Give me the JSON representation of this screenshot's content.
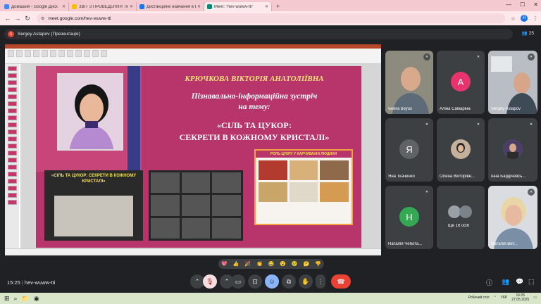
{
  "browser": {
    "tabs": [
      {
        "title": "Домашня - Google Диск",
        "color": "#4285f4",
        "active": false
      },
      {
        "title": "ЗВІТ З ПРОВЕДЕННЯ ТИЖНЯ",
        "color": "#fbbc04",
        "active": false
      },
      {
        "title": "Дистанційне навчання в ВСП",
        "color": "#1a73e8",
        "active": false
      },
      {
        "title": "Meet: \"hev-wuww-tti\"",
        "color": "#00897b",
        "active": true
      }
    ],
    "new_tab": "+",
    "url": "meet.google.com/hev-wuww-tti"
  },
  "meet": {
    "presenter_label": "Sergey Astapov (Презентація)",
    "participant_count": "25",
    "meeting_code": "hev-wuww-tti",
    "time": "15:25",
    "reactions": [
      "💖",
      "👍",
      "🎉",
      "👏",
      "😂",
      "😮",
      "😢",
      "🤔",
      "👎"
    ]
  },
  "slide": {
    "name": "КРЮЧКОВА ВІКТОРІЯ АНАТОЛІЇВНА",
    "subtitle1": "Пізнавально-інформаційна зустріч",
    "subtitle2": "на тему:",
    "topic1": "«СІЛЬ ТА ЦУКОР:",
    "topic2": "СЕКРЕТИ В КОЖНОМУ КРИСТАЛІ»",
    "left_caption": "«СІЛЬ ТА ЦУКОР: СЕКРЕТИ В КОЖНОМУ КРИСТАЛІ»",
    "food_caption": "РОЛЬ ЦУКРУ У ХАРЧУВАННІ ЛЮДИНИ"
  },
  "participants": [
    {
      "name": "valera boyus",
      "letter": "",
      "color": "#6b6b6b"
    },
    {
      "name": "Аліна Самаріна",
      "letter": "А",
      "color": "#e8336d"
    },
    {
      "name": "Sergey Astapov",
      "letter": "",
      "color": "#7a7f84"
    },
    {
      "name": "Яна Ткаченко",
      "letter": "Я",
      "color": "#5f6368"
    },
    {
      "name": "Олена Вікторівн...",
      "letter": "",
      "color": "#4a4a4a"
    },
    {
      "name": "Інна Бардічевсь...",
      "letter": "",
      "color": "#4a4a4a"
    },
    {
      "name": "Наталія Чебота...",
      "letter": "Н",
      "color": "#34a853"
    },
    {
      "name": "Ще 16 осіб",
      "letter": "",
      "color": "#5f6368"
    },
    {
      "name": "Наталія Вит...",
      "letter": "",
      "color": "#c7ccd3"
    }
  ],
  "taskbar": {
    "lang": "УКР",
    "time": "15:25",
    "date": "27.05.2025",
    "desktop": "Робочий стіл"
  }
}
